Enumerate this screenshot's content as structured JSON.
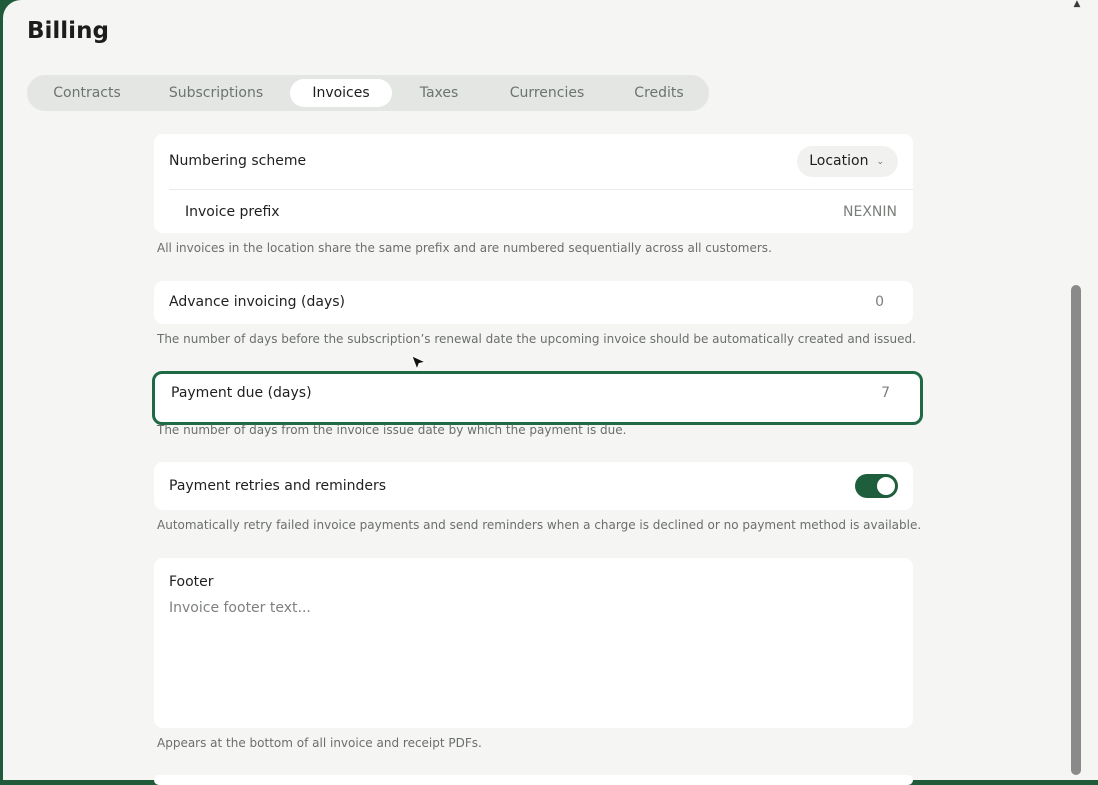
{
  "page": {
    "title": "Billing"
  },
  "tabs": [
    {
      "label": "Contracts"
    },
    {
      "label": "Subscriptions"
    },
    {
      "label": "Invoices",
      "active": true
    },
    {
      "label": "Taxes"
    },
    {
      "label": "Currencies"
    },
    {
      "label": "Credits"
    }
  ],
  "numbering": {
    "label": "Numbering scheme",
    "value": "Location",
    "prefix_label": "Invoice prefix",
    "prefix_value": "NEXNIN",
    "help": "All invoices in the location share the same prefix and are numbered sequentially across all customers."
  },
  "advance": {
    "label": "Advance invoicing (days)",
    "value": "0",
    "help": "The number of days before the subscription’s renewal date the upcoming invoice should be automatically created and issued."
  },
  "payment_due": {
    "label": "Payment due (days)",
    "value": "7",
    "help": "The number of days from the invoice issue date by which the payment is due."
  },
  "retries": {
    "label": "Payment retries and reminders",
    "enabled": true,
    "help": "Automatically retry failed invoice payments and send reminders when a charge is declined or no payment method is available."
  },
  "footer": {
    "label": "Footer",
    "placeholder": "Invoice footer text...",
    "help": "Appears at the bottom of all invoice and receipt PDFs."
  },
  "colors": {
    "accent": "#1f6a45",
    "toggle_on": "#1e5e3c",
    "window_bg": "#1f5a3a"
  }
}
